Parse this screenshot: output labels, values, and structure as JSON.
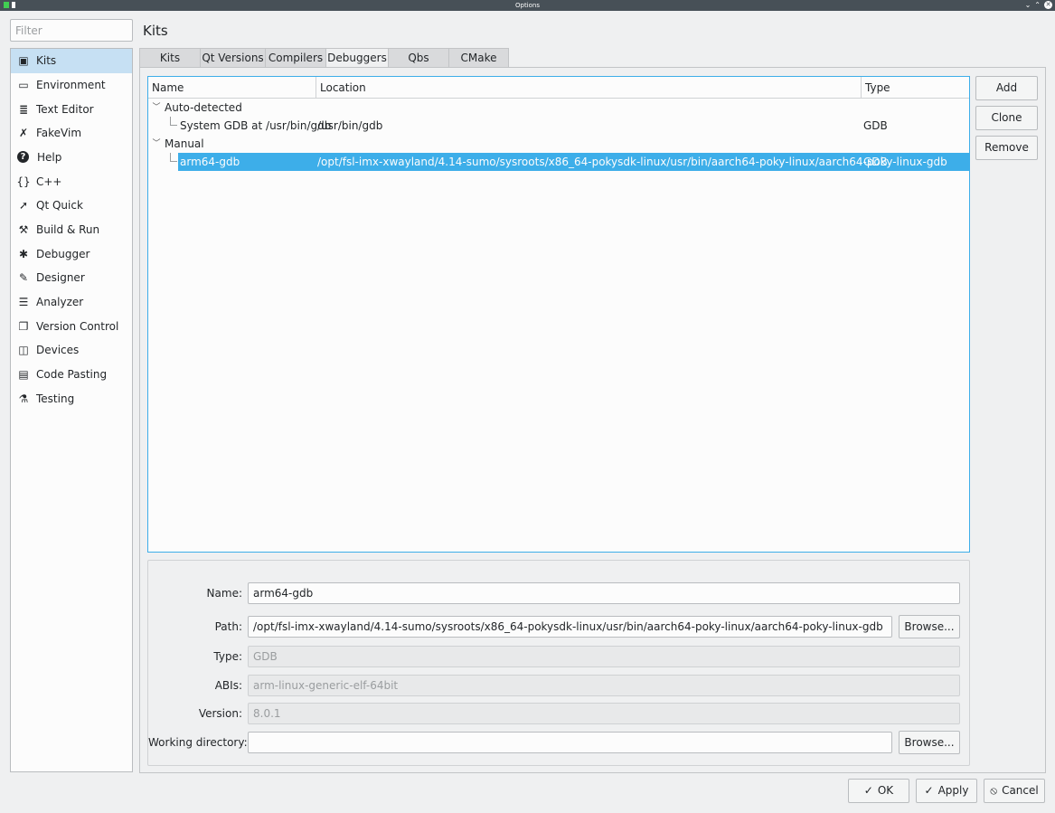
{
  "window": {
    "title": "Options",
    "controls": [
      "⌄",
      "⌃",
      "✕"
    ]
  },
  "filter": {
    "placeholder": "Filter",
    "value": ""
  },
  "sidebar": {
    "items": [
      {
        "label": "Kits",
        "icon": "▣"
      },
      {
        "label": "Environment",
        "icon": "▭"
      },
      {
        "label": "Text Editor",
        "icon": "≣"
      },
      {
        "label": "FakeVim",
        "icon": "✗"
      },
      {
        "label": "Help",
        "icon": "?"
      },
      {
        "label": "C++",
        "icon": "{}"
      },
      {
        "label": "Qt Quick",
        "icon": "➚"
      },
      {
        "label": "Build & Run",
        "icon": "⚒"
      },
      {
        "label": "Debugger",
        "icon": "✱"
      },
      {
        "label": "Designer",
        "icon": "✎"
      },
      {
        "label": "Analyzer",
        "icon": "☰"
      },
      {
        "label": "Version Control",
        "icon": "❐"
      },
      {
        "label": "Devices",
        "icon": "◫"
      },
      {
        "label": "Code Pasting",
        "icon": "▤"
      },
      {
        "label": "Testing",
        "icon": "⚗"
      }
    ],
    "selected": "Kits"
  },
  "page_title": "Kits",
  "tabs": [
    "Kits",
    "Qt Versions",
    "Compilers",
    "Debuggers",
    "Qbs",
    "CMake"
  ],
  "active_tab": "Debuggers",
  "debugger_table": {
    "headers": {
      "name": "Name",
      "location": "Location",
      "type": "Type"
    },
    "groups": [
      {
        "label": "Auto-detected",
        "rows": [
          {
            "name": "System GDB at /usr/bin/gdb",
            "location": "/usr/bin/gdb",
            "type": "GDB"
          }
        ]
      },
      {
        "label": "Manual",
        "rows": [
          {
            "name": "arm64-gdb",
            "location": "/opt/fsl-imx-xwayland/4.14-sumo/sysroots/x86_64-pokysdk-linux/usr/bin/aarch64-poky-linux/aarch64-poky-linux-gdb",
            "type": "GDB",
            "selected": true
          }
        ]
      }
    ]
  },
  "side_buttons": {
    "add": "Add",
    "clone": "Clone",
    "remove": "Remove"
  },
  "details": {
    "name_label": "Name:",
    "name_value": "arm64-gdb",
    "path_label": "Path:",
    "path_value": "/opt/fsl-imx-xwayland/4.14-sumo/sysroots/x86_64-pokysdk-linux/usr/bin/aarch64-poky-linux/aarch64-poky-linux-gdb",
    "browse_label": "Browse...",
    "type_label": "Type:",
    "type_value": "GDB",
    "abis_label": "ABIs:",
    "abis_value": "arm-linux-generic-elf-64bit",
    "version_label": "Version:",
    "version_value": "8.0.1",
    "workdir_label": "Working directory:",
    "workdir_value": "",
    "workdir_browse_label": "Browse..."
  },
  "dialog_buttons": {
    "ok": "OK",
    "apply": "Apply",
    "cancel": "Cancel"
  },
  "colors": {
    "accent": "#3daee9",
    "selection_bg": "#c6e0f3",
    "titlebar": "#475057"
  }
}
